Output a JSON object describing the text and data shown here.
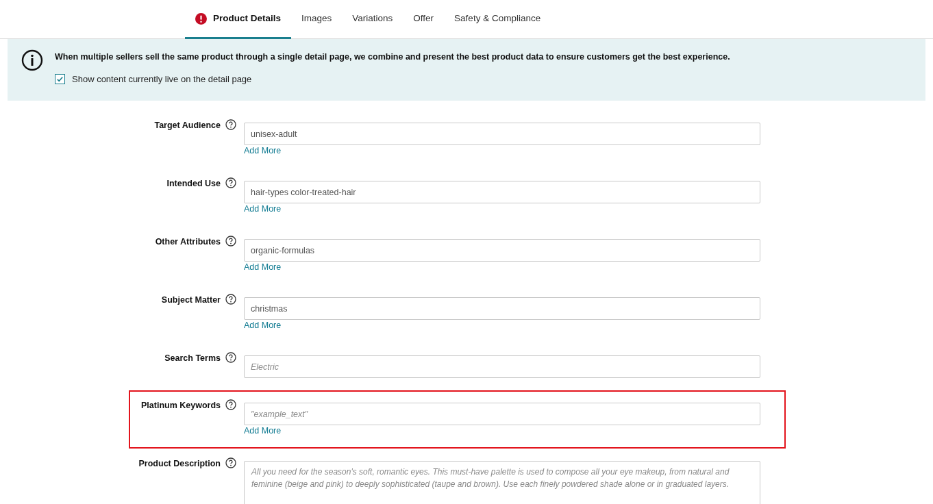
{
  "tabs": [
    {
      "label": "Product Details",
      "selected": true,
      "error": true
    },
    {
      "label": "Images",
      "selected": false,
      "error": false
    },
    {
      "label": "Variations",
      "selected": false,
      "error": false
    },
    {
      "label": "Offer",
      "selected": false,
      "error": false
    },
    {
      "label": "Safety & Compliance",
      "selected": false,
      "error": false
    }
  ],
  "notice": {
    "text": "When multiple sellers sell the same product through a single detail page, we combine and present the best product data to ensure customers get the best experience.",
    "checkbox": {
      "label": "Show content currently live on the detail page",
      "checked": true
    }
  },
  "fields": [
    {
      "kind": "input",
      "label": "Target Audience",
      "value": "unisex-adult",
      "add_more": "Add More",
      "highlighted": false
    },
    {
      "kind": "input",
      "label": "Intended Use",
      "value": "hair-types color-treated-hair",
      "add_more": "Add More",
      "highlighted": false
    },
    {
      "kind": "input",
      "label": "Other Attributes",
      "value": "organic-formulas",
      "add_more": "Add More",
      "highlighted": false
    },
    {
      "kind": "input",
      "label": "Subject Matter",
      "value": "christmas",
      "add_more": "Add More",
      "highlighted": false
    },
    {
      "kind": "input",
      "label": "Search Terms",
      "placeholder": "Electric",
      "highlighted": false
    },
    {
      "kind": "input",
      "label": "Platinum Keywords",
      "placeholder": "\"example_text\"",
      "add_more": "Add More",
      "highlighted": true
    },
    {
      "kind": "textarea",
      "label": "Product Description",
      "placeholder": "All you need for the season's soft, romantic eyes. This must-have palette is used to compose all your eye makeup, from natural and feminine (beige and pink) to deeply sophisticated (taupe and brown). Use each finely powdered shade alone or in graduated layers.",
      "highlighted": false
    }
  ]
}
